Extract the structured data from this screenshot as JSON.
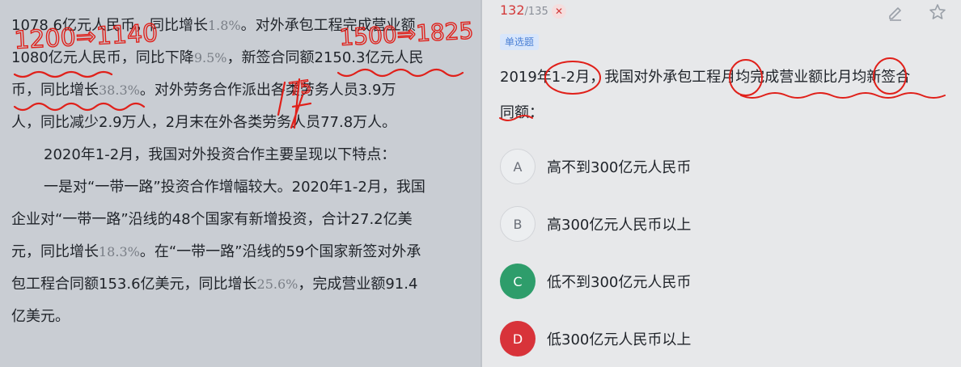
{
  "passage": {
    "lines": [
      {
        "parts": [
          {
            "t": "1078.6亿元人民币，同比增长"
          },
          {
            "t": "1.8%",
            "n": true
          },
          {
            "t": "。对外承包工程完成营业额"
          }
        ]
      },
      {
        "parts": [
          {
            "t": "1080亿元人民币，同比下降"
          },
          {
            "t": "9.5%",
            "n": true
          },
          {
            "t": "，新签合同额2150.3亿元人民"
          }
        ]
      },
      {
        "parts": [
          {
            "t": "币，同比增长"
          },
          {
            "t": "38.3%",
            "n": true
          },
          {
            "t": "。对外劳务合作派出各类劳务人员3.9万"
          }
        ]
      },
      {
        "parts": [
          {
            "t": "人，同比减少2.9万人，2月末在外各类劳务人员77.8万人。"
          }
        ]
      },
      {
        "indent": true,
        "parts": [
          {
            "t": "2020年1-2月，我国对外投资合作主要呈现以下特点："
          }
        ]
      },
      {
        "indent": true,
        "parts": [
          {
            "t": "一是对“一带一路”投资合作增幅较大。2020年1-2月，我国"
          }
        ]
      },
      {
        "parts": [
          {
            "t": "企业对“一带一路”沿线的48个国家有新增投资，合计27.2亿美"
          }
        ]
      },
      {
        "parts": [
          {
            "t": "元，同比增长"
          },
          {
            "t": "18.3%",
            "n": true
          },
          {
            "t": "。在“一带一路”沿线的59个国家新签对外承"
          }
        ]
      },
      {
        "parts": [
          {
            "t": "包工程合同额153.6亿美元，同比增长"
          },
          {
            "t": "25.6%",
            "n": true
          },
          {
            "t": "，完成营业额91.4"
          }
        ]
      },
      {
        "parts": [
          {
            "t": "亿美元。"
          }
        ]
      }
    ]
  },
  "annotations": {
    "left_calc_1": "1200 ⇒ 1140",
    "left_calc_2": "1500 ⇒ 1825",
    "left_mark": "75",
    "left_mark_2": "1x"
  },
  "header": {
    "progress_current": "132",
    "progress_total": "/135",
    "close_glyph": "✕"
  },
  "question": {
    "type_label": "单选题",
    "line1": "2019年1-2月，我国对外承包工程月均完成营业额比月均新签合",
    "line2": "同额："
  },
  "options": [
    {
      "letter": "A",
      "label": "高不到300亿元人民币",
      "state": "plain"
    },
    {
      "letter": "B",
      "label": "高300亿元人民币以上",
      "state": "plain"
    },
    {
      "letter": "C",
      "label": "低不到300亿元人民币",
      "state": "correct"
    },
    {
      "letter": "D",
      "label": "低300亿元人民币以上",
      "state": "wrong"
    }
  ],
  "colors": {
    "ink": "#e0201a",
    "correct": "#2e9d6b",
    "wrong": "#d8333a",
    "progress": "#d33a3a"
  },
  "icons": {
    "edit": "pencil-icon",
    "star": "star-icon"
  }
}
